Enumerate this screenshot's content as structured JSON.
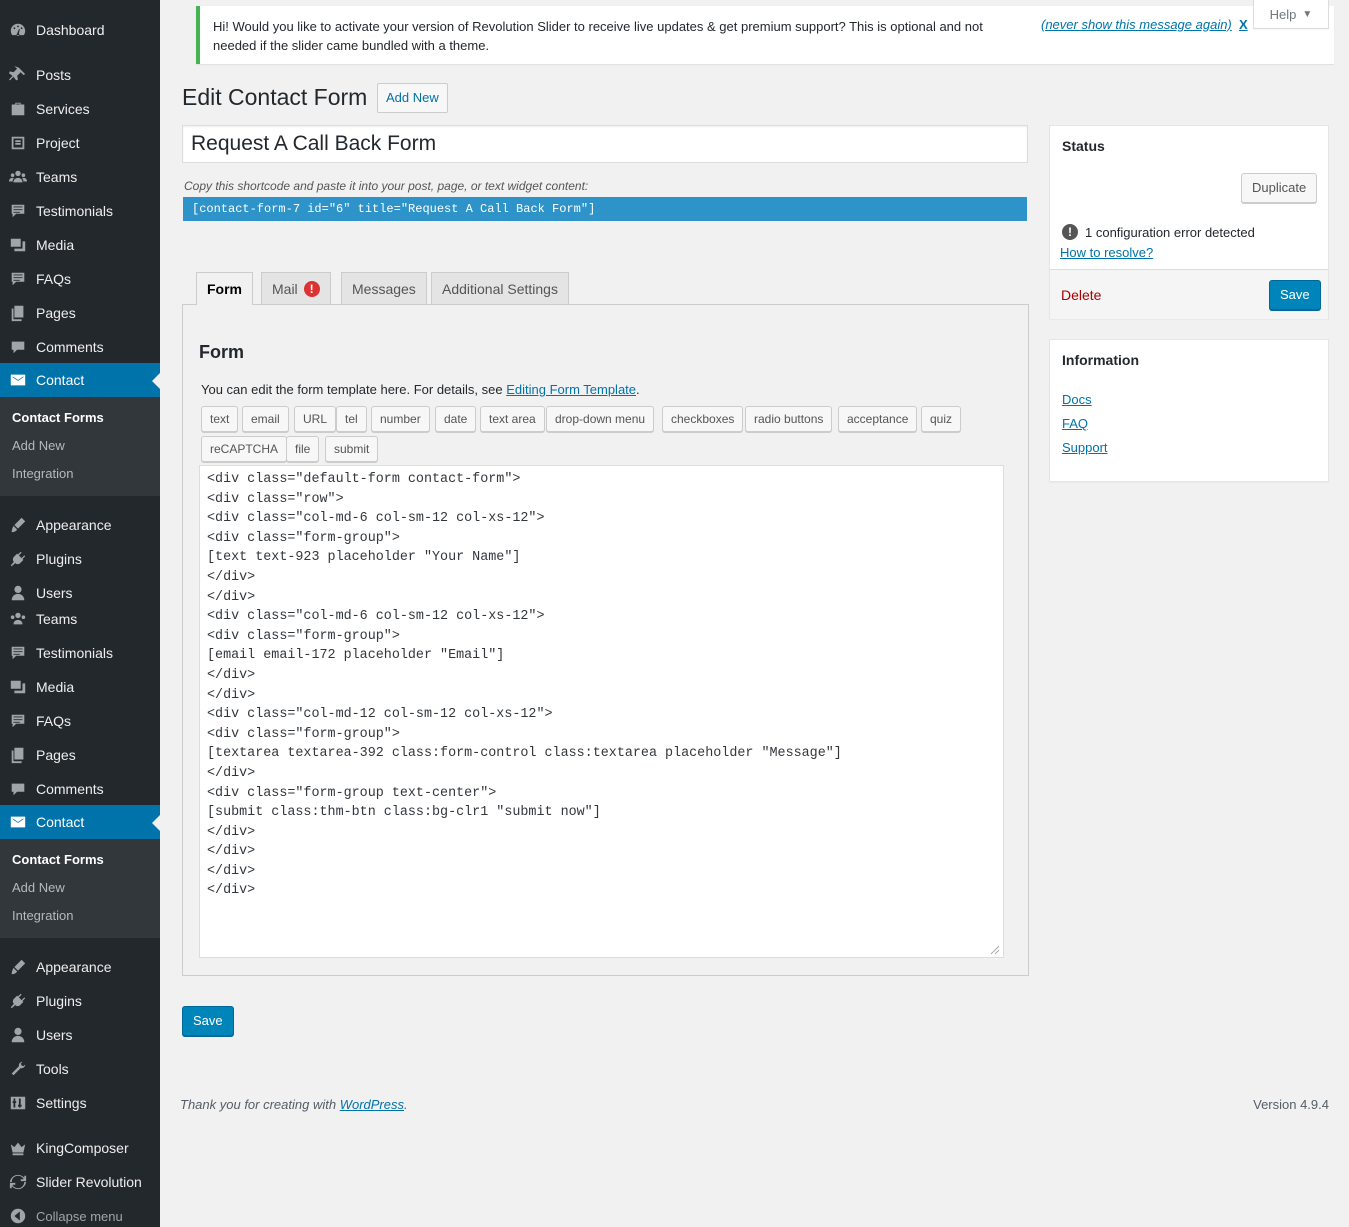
{
  "sidebar": {
    "items": [
      {
        "label": "Dashboard",
        "icon": "dashboard-icon"
      },
      {
        "label": "Posts",
        "icon": "pin-icon"
      },
      {
        "label": "Services",
        "icon": "briefcase-icon"
      },
      {
        "label": "Project",
        "icon": "portfolio-icon"
      },
      {
        "label": "Teams",
        "icon": "groups-icon"
      },
      {
        "label": "Testimonials",
        "icon": "comment-icon"
      },
      {
        "label": "Media",
        "icon": "media-icon"
      },
      {
        "label": "FAQs",
        "icon": "comment-icon"
      },
      {
        "label": "Pages",
        "icon": "pages-icon"
      },
      {
        "label": "Comments",
        "icon": "speech-bubble-icon"
      },
      {
        "label": "Contact",
        "icon": "envelope-icon"
      }
    ],
    "contact_submenu": [
      "Contact Forms",
      "Add New",
      "Integration"
    ],
    "items_lower": [
      {
        "label": "Appearance",
        "icon": "brush-icon"
      },
      {
        "label": "Plugins",
        "icon": "plug-icon"
      },
      {
        "label": "Users",
        "icon": "user-icon"
      },
      {
        "label": "Teams",
        "icon": "groups-icon"
      },
      {
        "label": "Testimonials",
        "icon": "comment-icon"
      },
      {
        "label": "Media",
        "icon": "media-icon"
      },
      {
        "label": "FAQs",
        "icon": "comment-icon"
      },
      {
        "label": "Pages",
        "icon": "pages-icon"
      },
      {
        "label": "Comments",
        "icon": "speech-bubble-icon"
      },
      {
        "label": "Contact",
        "icon": "envelope-icon"
      }
    ],
    "contact_submenu_2": [
      "Contact Forms",
      "Add New",
      "Integration"
    ],
    "items_bottom": [
      {
        "label": "Appearance",
        "icon": "brush-icon"
      },
      {
        "label": "Plugins",
        "icon": "plug-icon"
      },
      {
        "label": "Users",
        "icon": "user-icon"
      },
      {
        "label": "Tools",
        "icon": "wrench-icon"
      },
      {
        "label": "Settings",
        "icon": "settings-icon"
      },
      {
        "label": "KingComposer",
        "icon": "crown-icon"
      },
      {
        "label": "Slider Revolution",
        "icon": "refresh-icon"
      }
    ],
    "collapse_label": "Collapse menu"
  },
  "notice": {
    "message": "Hi! Would you like to activate your version of Revolution Slider to receive live updates & get premium support? This is optional and not needed if the slider came bundled with a theme.",
    "dismiss_label": "(never show this message again)",
    "close_label": "X"
  },
  "help_label": "Help",
  "page_title": "Edit Contact Form",
  "add_new_label": "Add New",
  "form_title_value": "Request A Call Back Form",
  "shortcode_hint": "Copy this shortcode and paste it into your post, page, or text widget content:",
  "shortcode": "[contact-form-7 id=\"6\" title=\"Request A Call Back Form\"]",
  "tabs": [
    "Form",
    "Mail",
    "Messages",
    "Additional Settings"
  ],
  "mail_error_badge": "!",
  "form_panel": {
    "heading": "Form",
    "description": "You can edit the form template here. For details, see",
    "description_link": "Editing Form Template",
    "description_end": ".",
    "tag_buttons_row1": [
      "text",
      "email",
      "URL",
      "tel",
      "number",
      "date",
      "text area",
      "drop-down menu",
      "checkboxes",
      "radio buttons",
      "acceptance",
      "quiz"
    ],
    "tag_buttons_row2": [
      "reCAPTCHA",
      "file",
      "submit"
    ],
    "template": "<div class=\"default-form contact-form\">\n<div class=\"row\">\n<div class=\"col-md-6 col-sm-12 col-xs-12\">\n<div class=\"form-group\">\n[text text-923 placeholder \"Your Name\"]\n</div>\n</div>\n<div class=\"col-md-6 col-sm-12 col-xs-12\">\n<div class=\"form-group\">\n[email email-172 placeholder \"Email\"]\n</div>\n</div>\n<div class=\"col-md-12 col-sm-12 col-xs-12\">\n<div class=\"form-group\">\n[textarea textarea-392 class:form-control class:textarea placeholder \"Message\"]\n</div>\n<div class=\"form-group text-center\">\n[submit class:thm-btn class:bg-clr1 \"submit now\"]\n</div>\n</div>\n</div>\n</div>"
  },
  "save_label": "Save",
  "status_box": {
    "title": "Status",
    "duplicate_label": "Duplicate",
    "error_count": "1 configuration error detected",
    "error_icon": "!",
    "resolve_link": "How to resolve?",
    "delete_label": "Delete",
    "save_label": "Save"
  },
  "info_box": {
    "title": "Information",
    "links": [
      "Docs",
      "FAQ",
      "Support"
    ]
  },
  "footer": {
    "thanks": "Thank you for creating with",
    "wp_link": "WordPress",
    "thanks_end": ".",
    "version": "Version 4.9.4"
  },
  "colors": {
    "sidebar_bg": "#23282d",
    "accent": "#0073aa",
    "primary_button": "#0085ba",
    "shortcode_bg": "#2e93c9",
    "notice_border": "#46b450",
    "error": "#dc3232",
    "delete": "#aa0000"
  }
}
